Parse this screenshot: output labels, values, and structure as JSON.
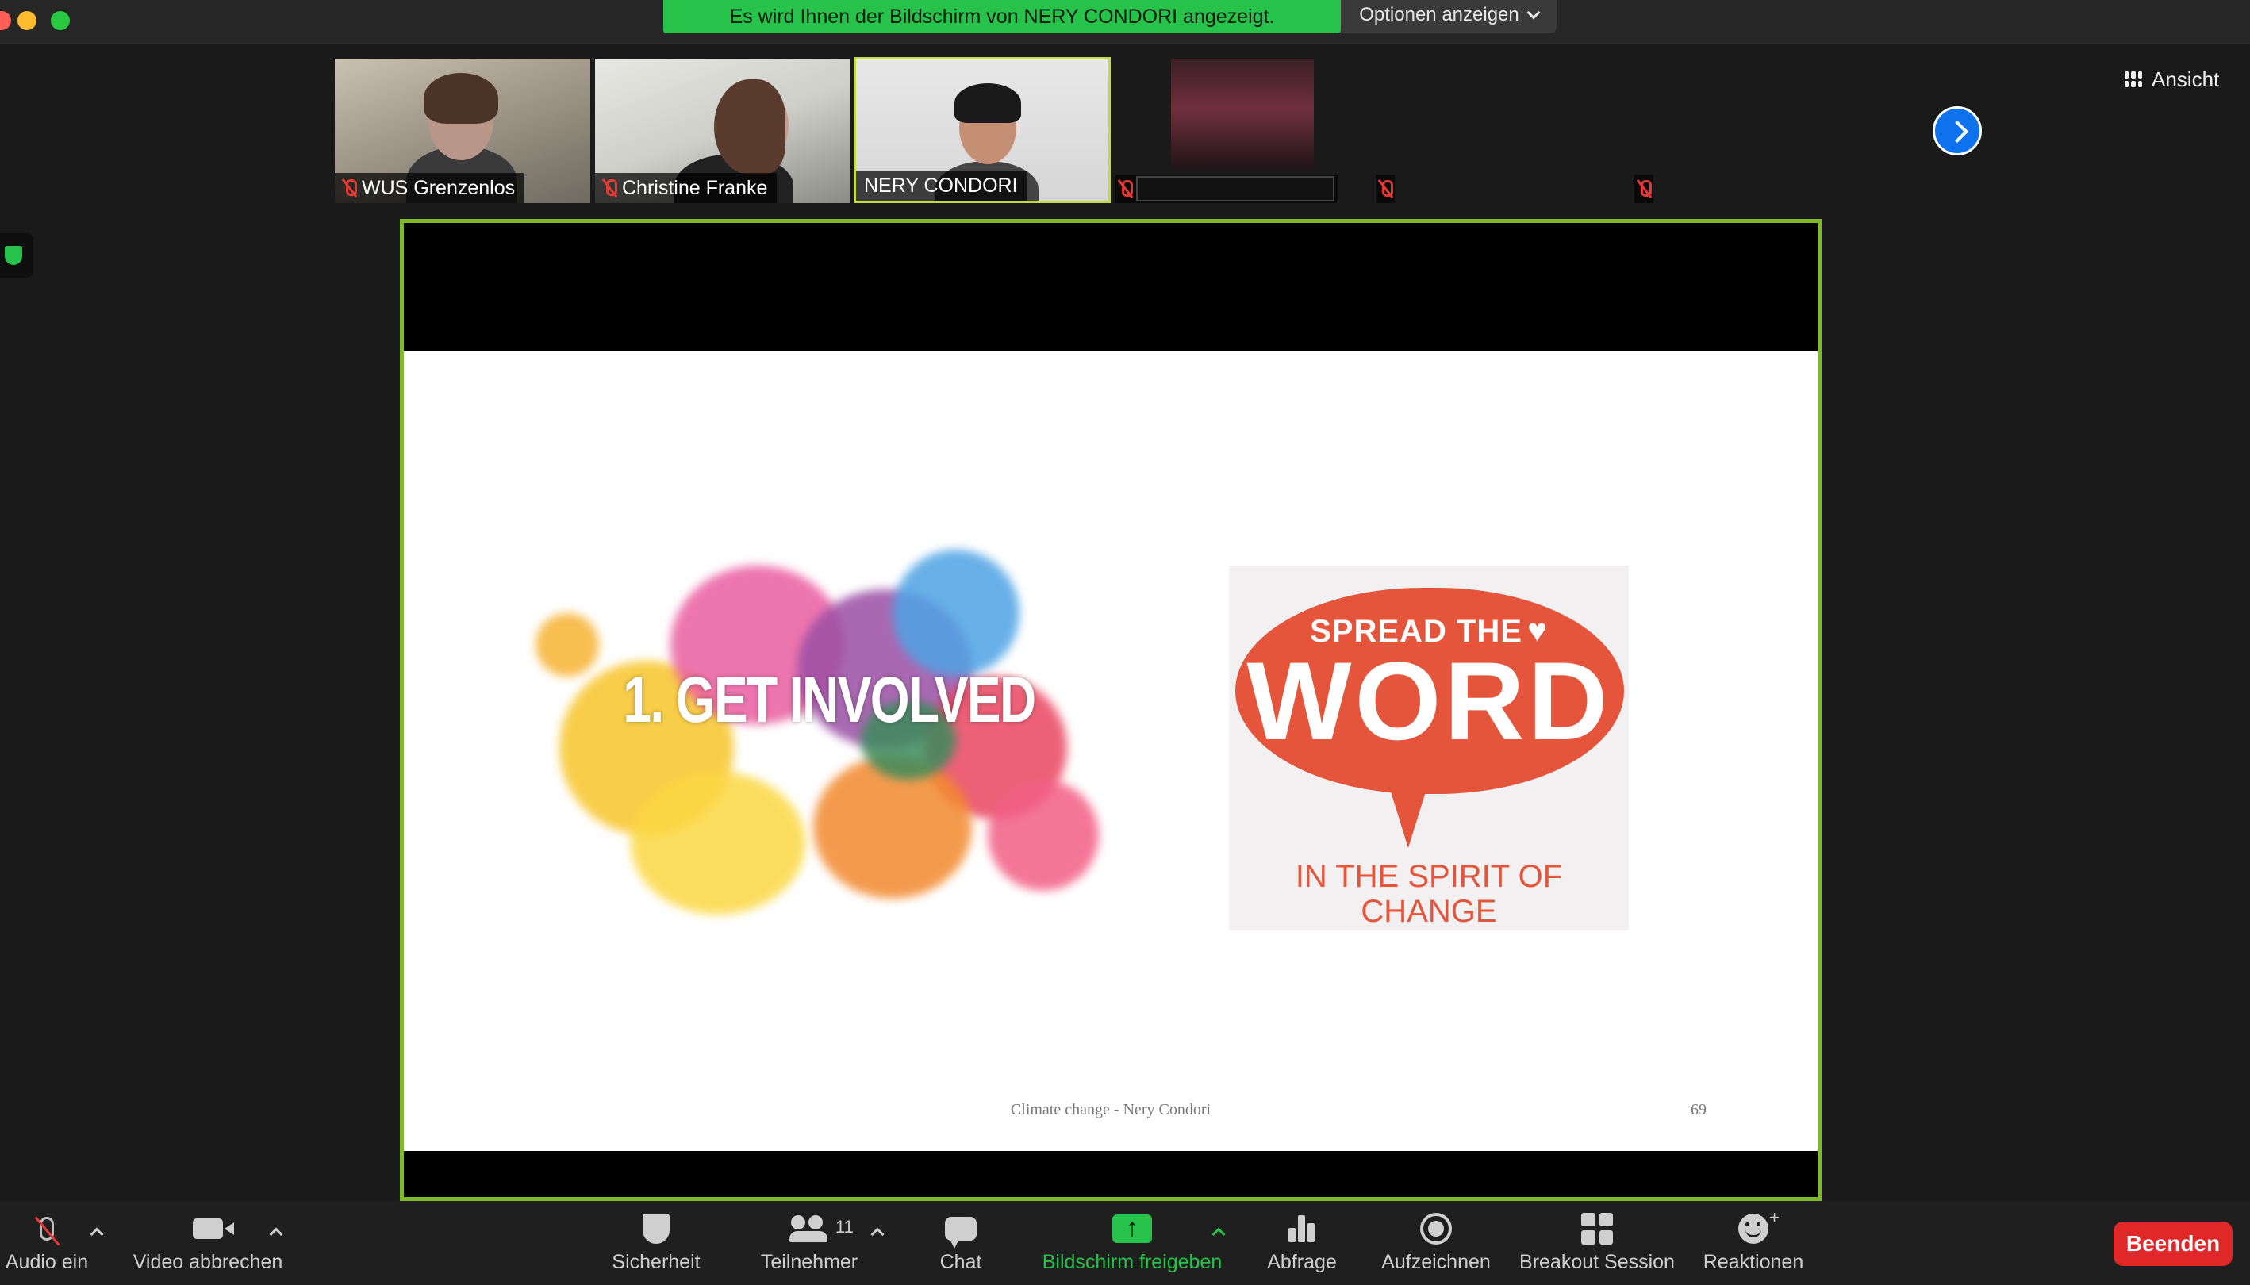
{
  "banner": {
    "message": "Es wird Ihnen der Bildschirm von NERY CONDORI angezeigt.",
    "options_label": "Optionen anzeigen"
  },
  "view": {
    "label": "Ansicht"
  },
  "participants": [
    {
      "name": "WUS Grenzenlos",
      "muted": true
    },
    {
      "name": "Christine Franke",
      "muted": true
    },
    {
      "name": "NERY CONDORI",
      "muted": false,
      "active_speaker": true
    }
  ],
  "slide": {
    "left_graphic_text": "1. GET INVOLVED",
    "right_graphic_top": "SPREAD THE",
    "right_graphic_main": "WORD",
    "right_graphic_bottom": "IN THE SPIRIT OF CHANGE",
    "footer": "Climate change  - Nery Condori",
    "page_number": "69"
  },
  "toolbar": {
    "audio_label": "Audio ein",
    "video_label": "Video abbrechen",
    "security_label": "Sicherheit",
    "participants_label": "Teilnehmer",
    "participants_count": "11",
    "chat_label": "Chat",
    "share_label": "Bildschirm freigeben",
    "poll_label": "Abfrage",
    "record_label": "Aufzeichnen",
    "breakout_label": "Breakout Session",
    "reactions_label": "Reaktionen",
    "end_label": "Beenden"
  },
  "colors": {
    "accent_green": "#26c24a",
    "active_border": "#7fba2b",
    "end_red": "#e02828",
    "bubble_orange": "#e4553b",
    "link_blue": "#0e72ed"
  }
}
